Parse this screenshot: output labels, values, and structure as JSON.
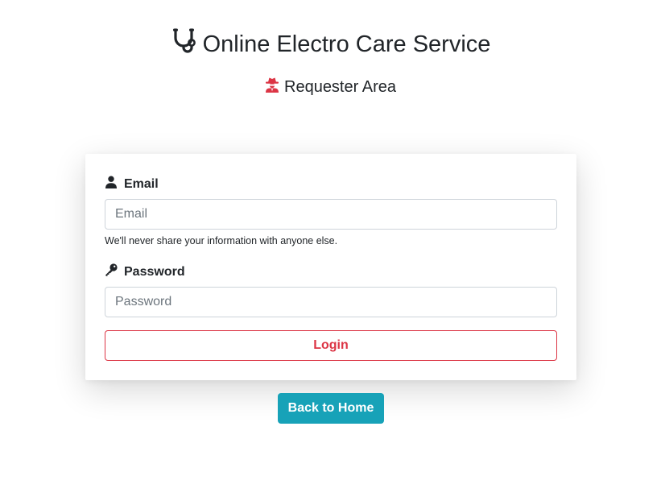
{
  "header": {
    "title": "Online Electro Care Service",
    "title_icon": "stethoscope-icon",
    "subtitle": "Requester Area",
    "subtitle_icon": "user-secret-icon",
    "subtitle_icon_color": "#dc3545"
  },
  "form": {
    "email_label": "Email",
    "email_icon": "user-icon",
    "email_placeholder": "Email",
    "email_value": "",
    "email_help": "We'll never share your information with anyone else.",
    "password_label": "Password",
    "password_icon": "key-icon",
    "password_placeholder": "Password",
    "password_value": "",
    "login_label": "Login",
    "login_color": "#dc3545"
  },
  "footer": {
    "home_label": "Back to Home",
    "home_color": "#17a2b8"
  }
}
